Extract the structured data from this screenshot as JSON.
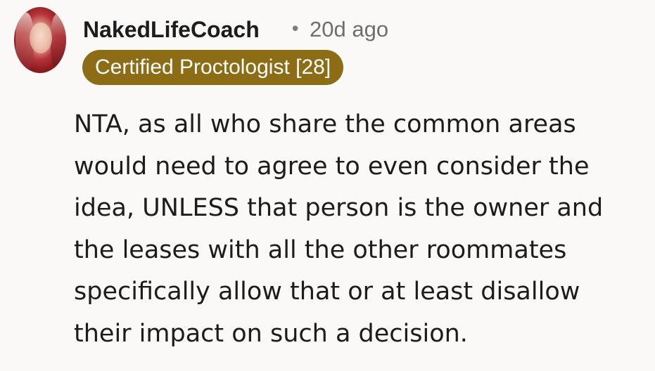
{
  "comment": {
    "username": "NakedLifeCoach",
    "separator": "•",
    "timestamp": "20d ago",
    "flair": {
      "text": "Certified Proctologist [28]",
      "color": "#8c6c14"
    },
    "body_lines": [
      "NTA, as all who share the common areas",
      "would need to agree to even consider the",
      "idea, UNLESS that person is the owner and",
      "the leases with all the other roommates",
      "specifically allow that or at least disallow",
      "their impact on such a decision."
    ]
  }
}
